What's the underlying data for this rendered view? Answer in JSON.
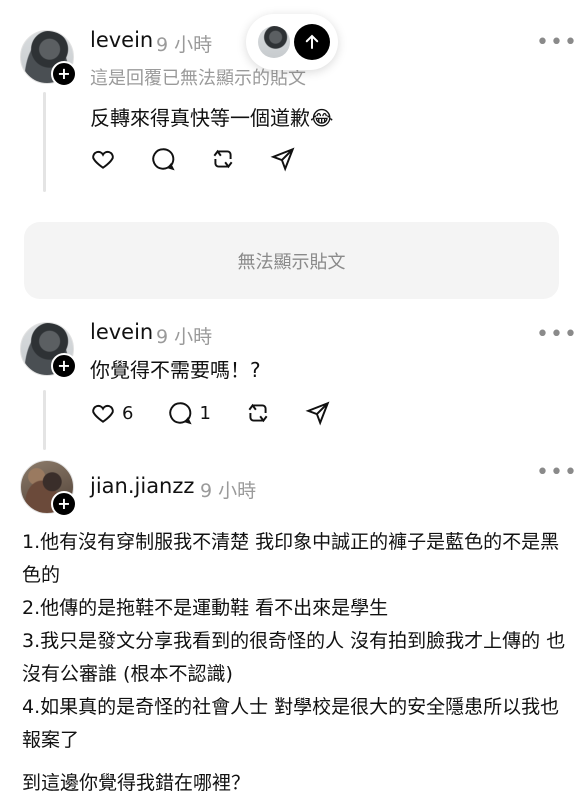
{
  "post1": {
    "username": "levein",
    "time": "9 小時",
    "reply_note": "這是回覆已無法顯示的貼文",
    "text": "反轉來得真快等一個道歉😂",
    "more": "•••"
  },
  "unavailable_text": "無法顯示貼文",
  "post2": {
    "username": "levein",
    "time": "9 小時",
    "text": "你覺得不需要嗎！?",
    "likes": "6",
    "comments": "1",
    "more": "•••"
  },
  "post3": {
    "username": "jian.jianzz",
    "time": "9 小時",
    "more": "•••",
    "paragraphs": [
      "1.他有沒有穿制服我不清楚 我印象中誠正的褲子是藍色的不是黑色的",
      "2.他傳的是拖鞋不是運動鞋 看不出來是學生",
      "3.我只是發文分享我看到的很奇怪的人 沒有拍到臉我才上傳的 也沒有公審誰 (根本不認識)",
      "4.如果真的是奇怪的社會人士 對學校是很大的安全隱患所以我也報案了",
      "到這邊你覺得我錯在哪裡？"
    ]
  },
  "icons": [
    "heart-icon",
    "comment-icon",
    "repost-icon",
    "share-icon",
    "up-arrow-icon",
    "plus-icon"
  ],
  "colors": {
    "accent": "#000000",
    "muted": "#9a9a9a",
    "thread": "#e4e4e4"
  }
}
